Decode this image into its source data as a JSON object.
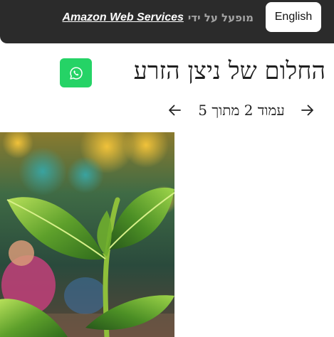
{
  "header": {
    "language_button": "English",
    "powered_by_text": "מופעל על ידי",
    "powered_by_link": "Amazon Web Services"
  },
  "main": {
    "title": "החלום של ניצן הזרע",
    "share_icon": "whatsapp-icon",
    "pagination": {
      "label": "עמוד 2 מתוך 5",
      "current_page": 2,
      "total_pages": 5
    }
  },
  "colors": {
    "header_bg": "#2b2b2b",
    "whatsapp_green": "#25d366"
  }
}
